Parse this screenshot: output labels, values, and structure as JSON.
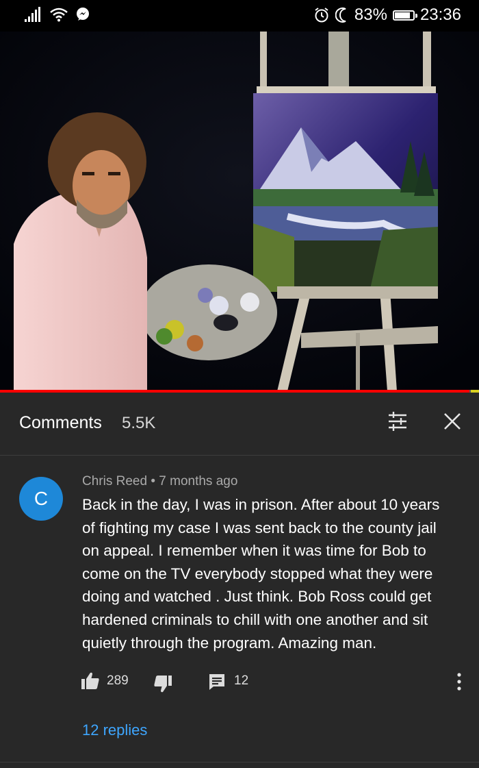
{
  "status_bar": {
    "battery_text": "83%",
    "battery_level": 0.83,
    "time": "23:36",
    "icons": [
      "signal-icon",
      "wifi-icon",
      "messenger-icon",
      "alarm-icon",
      "do-not-disturb-moon-icon",
      "battery-icon"
    ]
  },
  "video": {
    "progress": 0.98
  },
  "comments_header": {
    "title": "Comments",
    "count": "5.5K",
    "icons": [
      "sort-icon",
      "close-icon"
    ]
  },
  "comment": {
    "avatar_letter": "C",
    "avatar_color": "#1e88d8",
    "author": "Chris Reed",
    "separator": "•",
    "time": "7 months ago",
    "lines": [
      "Back in the day, I was in prison. After about 10 years",
      "of fighting my case I was sent back to the county jail",
      "on appeal. I remember when it was time for Bob to",
      "come on the TV everybody stopped what they were",
      "doing and watched . Just think. Bob Ross could get",
      "hardened criminals to chill with one another and sit",
      "quietly through the program. Amazing man."
    ],
    "likes": "289",
    "reply_count": "12",
    "replies_link": "12 replies"
  },
  "colors": {
    "background": "#282828",
    "link": "#3ea6ff",
    "progress": "#ff0000"
  }
}
